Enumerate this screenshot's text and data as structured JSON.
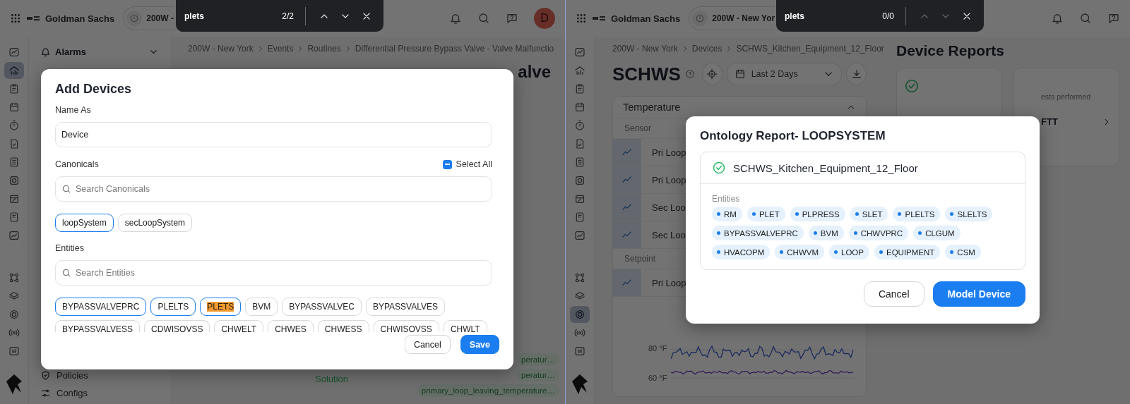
{
  "left_pane": {
    "top_bar": {
      "org": "Goldman Sachs",
      "site": "200W -",
      "avatar": "D"
    },
    "find_bar": {
      "query": "plets",
      "count": "2/2",
      "prev_enabled": true,
      "next_enabled": true
    },
    "rail": [
      {
        "selected": false
      },
      {
        "selected": true
      },
      {
        "selected": false
      },
      {
        "selected": false
      },
      {
        "selected": false
      },
      {
        "selected": false
      },
      {
        "selected": false
      },
      {
        "selected": false
      },
      {
        "selected": false
      },
      {
        "selected": false
      },
      {
        "selected": false
      },
      {
        "selected": false
      },
      {
        "selected": false
      },
      {
        "selected": false
      },
      {
        "selected": false
      },
      {
        "selected": false
      }
    ],
    "sidebar": {
      "section": "Alarms",
      "items": [
        {
          "label": "Policies"
        },
        {
          "label": "Configs"
        }
      ]
    },
    "breadcrumb": [
      "200W - New York",
      "Events",
      "Routines",
      "Differential Pressure Bypass Valve - Valve Malfunctio"
    ],
    "page_title": "alve",
    "solution": "Solution",
    "tags": [
      "peratur…",
      "peratur…",
      "primary_loop_leaving_temperature…"
    ],
    "dialog": {
      "title": "Add Devices",
      "name_field": {
        "label": "Name As",
        "value": "Device"
      },
      "canonicals": {
        "label": "Canonicals",
        "select_all": {
          "label": "Select All",
          "indeterminate": true
        },
        "search_placeholder": "Search Canonicals",
        "chips": [
          {
            "label": "loopSystem",
            "selected": true
          },
          {
            "label": "secLoopSystem",
            "selected": false
          }
        ]
      },
      "entities": {
        "label": "Entities",
        "search_placeholder": "Search Entities",
        "chips": [
          {
            "label": "BYPASSVALVEPRC",
            "selected": true,
            "match": false
          },
          {
            "label": "PLELTS",
            "selected": true,
            "match": false
          },
          {
            "label": "PLETS",
            "selected": true,
            "match": true
          },
          {
            "label": "BVM",
            "selected": false,
            "match": false
          },
          {
            "label": "BYPASSVALVEC",
            "selected": false,
            "match": false
          },
          {
            "label": "BYPASSVALVES",
            "selected": false,
            "match": false
          },
          {
            "label": "BYPASSVALVESS",
            "selected": false,
            "match": false
          },
          {
            "label": "CDWISOVSS",
            "selected": false,
            "match": false
          },
          {
            "label": "CHWELT",
            "selected": false,
            "match": false
          },
          {
            "label": "CHWES",
            "selected": false,
            "match": false
          },
          {
            "label": "CHWESS",
            "selected": false,
            "match": false
          },
          {
            "label": "CHWISOVSS",
            "selected": false,
            "match": false
          },
          {
            "label": "CHWLT",
            "selected": false,
            "match": false
          }
        ]
      },
      "buttons": [
        {
          "label": "Cancel",
          "kind": "secondary"
        },
        {
          "label": "Save",
          "kind": "primary"
        }
      ]
    }
  },
  "right_pane": {
    "top_bar": {
      "org": "Goldman Sachs",
      "site": "200W - New Yor"
    },
    "find_bar": {
      "query": "plets",
      "count": "0/0",
      "prev_enabled": false,
      "next_enabled": false
    },
    "rail": [
      {
        "selected": false
      },
      {
        "selected": false
      },
      {
        "selected": false
      },
      {
        "selected": false
      },
      {
        "selected": false
      },
      {
        "selected": false
      },
      {
        "selected": false
      },
      {
        "selected": false
      },
      {
        "selected": false
      },
      {
        "selected": false
      },
      {
        "selected": false
      },
      {
        "selected": false
      },
      {
        "selected": false
      },
      {
        "selected": true
      },
      {
        "selected": false
      },
      {
        "selected": false
      }
    ],
    "breadcrumb": [
      "200W - New York",
      "Devices",
      "SCHWS_Kitchen_Equipment_12_Floor"
    ],
    "title": "SCHWS",
    "date_range": "Last 2 Days",
    "panel": {
      "title": "Temperature",
      "groups": [
        {
          "label": "Sensor",
          "rows": [
            "Pri Loop",
            "Pri Loop",
            "Sec Loo",
            "Sec Loo"
          ]
        },
        {
          "label": "Setpoint",
          "rows": [
            "Pri Loop"
          ]
        }
      ],
      "chart_labels": [
        "80 °F",
        "60 °F"
      ]
    },
    "reports": {
      "title": "Device Reports",
      "cards": [
        {
          "kind": "passed"
        },
        {
          "kind": "tests",
          "text": "ests performed",
          "value": "FTT"
        }
      ]
    },
    "dialog": {
      "title": "Ontology Report- LOOPSYSTEM",
      "device": "SCHWS_Kitchen_Equipment_12_Floor",
      "verified": true,
      "entities_label": "Entities",
      "entities": [
        "RM",
        "PLET",
        "PLPRESS",
        "SLET",
        "PLELTS",
        "SLELTS",
        "BYPASSVALVEPRC",
        "BVM",
        "CHWVPRC",
        "CLGUM",
        "HVACOPM",
        "CHWVM",
        "LOOP",
        "EQUIPMENT",
        "CSM"
      ],
      "buttons": [
        {
          "label": "Cancel",
          "kind": "secondary"
        },
        {
          "label": "Model Device",
          "kind": "primary"
        }
      ]
    }
  }
}
